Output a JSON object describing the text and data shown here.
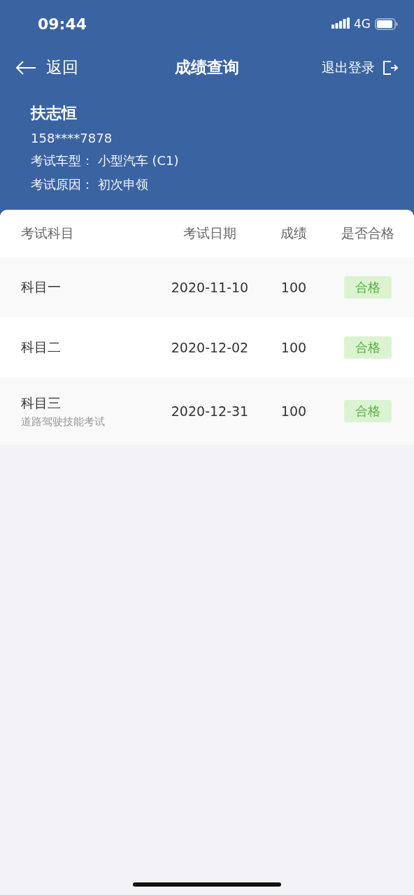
{
  "status_bar": {
    "time": "09:44",
    "network": "4G"
  },
  "nav": {
    "back_label": "返回",
    "title": "成绩查询",
    "logout_label": "退出登录"
  },
  "profile": {
    "name": "扶志恒",
    "phone": "158****7878",
    "lines": [
      {
        "label": "考试车型：",
        "value": "小型汽车 (C1)"
      },
      {
        "label": "考试原因：",
        "value": "初次申领"
      }
    ]
  },
  "table": {
    "columns": [
      "考试科目",
      "考试日期",
      "成绩",
      "是否合格"
    ],
    "rows": [
      {
        "subject": "科目一",
        "date": "2020-11-10",
        "score": "100",
        "result": "合格"
      },
      {
        "subject": "科目二",
        "date": "2020-12-02",
        "score": "100",
        "result": "合格"
      },
      {
        "subject": "科目三",
        "note": "道路驾驶技能考试",
        "date": "2020-12-31",
        "score": "100",
        "result": "合格"
      }
    ]
  }
}
